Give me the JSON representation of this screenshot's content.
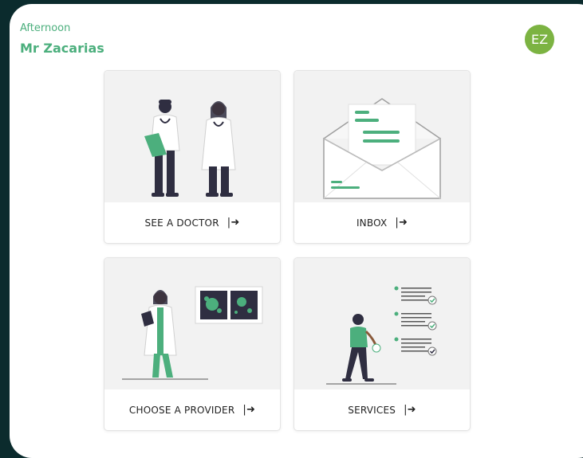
{
  "header": {
    "greeting": "Afternoon",
    "user_name": "Mr Zacarias",
    "avatar_initials": "EZ"
  },
  "cards": [
    {
      "label": "SEE A DOCTOR",
      "icon": "arrow-right-to-bar-icon"
    },
    {
      "label": "INBOX",
      "icon": "arrow-right-to-bar-icon"
    },
    {
      "label": "CHOOSE A PROVIDER",
      "icon": "arrow-right-to-bar-icon"
    },
    {
      "label": "SERVICES",
      "icon": "arrow-right-to-bar-icon"
    }
  ],
  "colors": {
    "background": "#0b2b2d",
    "panel": "#ffffff",
    "accent": "#4caf7d",
    "avatar": "#7cb342",
    "illustration_bg": "#f2f2f2",
    "dark": "#2f2e41"
  }
}
